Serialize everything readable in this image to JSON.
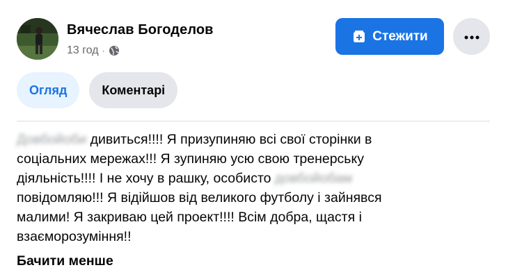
{
  "post": {
    "author_name": "Вячеслав Богоделов",
    "time": "13 год",
    "separator": "·",
    "follow_label": "Стежити"
  },
  "tabs": [
    {
      "label": "Огляд",
      "active": true
    },
    {
      "label": "Коментарі",
      "active": false
    }
  ],
  "body": {
    "line1_blurred": "Довбойоби",
    "line1_rest": " дивиться!!!! Я призупиняю всі свої сторінки в",
    "line2": "соціальних мережах!!! Я зупиняю усю свою тренерську",
    "line3_start": "діяльність!!!! І не хочу в рашку, особисто ",
    "line3_blurred": "довбойобам",
    "line4": "повідомляю!!! Я відійшов від великого футболу і зайнявся",
    "line5": "малими! Я закриваю цей проект!!!! Всім добра, щастя і",
    "line6": "взаєморозуміння!!",
    "see_less": "Бачити менше"
  },
  "colors": {
    "accent": "#1b74e4",
    "tab_active_bg": "#e7f3ff",
    "button_gray": "#e4e6eb",
    "meta_text": "#65676b"
  },
  "icons": {
    "globe": "globe-icon",
    "follow": "follow-icon",
    "more": "more-dots-icon"
  }
}
